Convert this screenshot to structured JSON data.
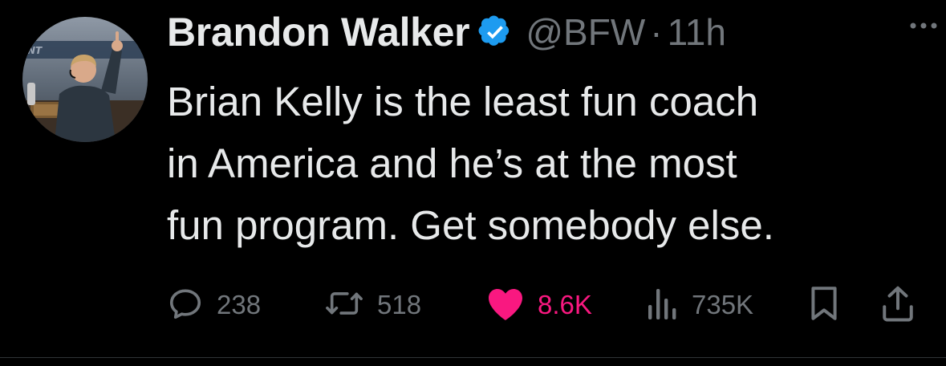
{
  "user": {
    "display_name": "Brandon Walker",
    "handle": "@BFW",
    "separator": "·",
    "time": "11h",
    "verified": true
  },
  "tweet": {
    "text": "Brian Kelly is the least fun coach\nin America and he’s at the most\nfun program. Get somebody else."
  },
  "actions": {
    "replies": "238",
    "retweets": "518",
    "likes": "8.6K",
    "views": "735K"
  },
  "colors": {
    "background": "#000000",
    "text_primary": "#e7e9ea",
    "text_secondary": "#71767b",
    "verified_blue": "#1d9bf0",
    "like_pink": "#f91880"
  },
  "icons": [
    "verified-badge-icon",
    "more-icon",
    "reply-icon",
    "retweet-icon",
    "like-heart-icon",
    "views-icon",
    "bookmark-icon",
    "share-icon"
  ]
}
